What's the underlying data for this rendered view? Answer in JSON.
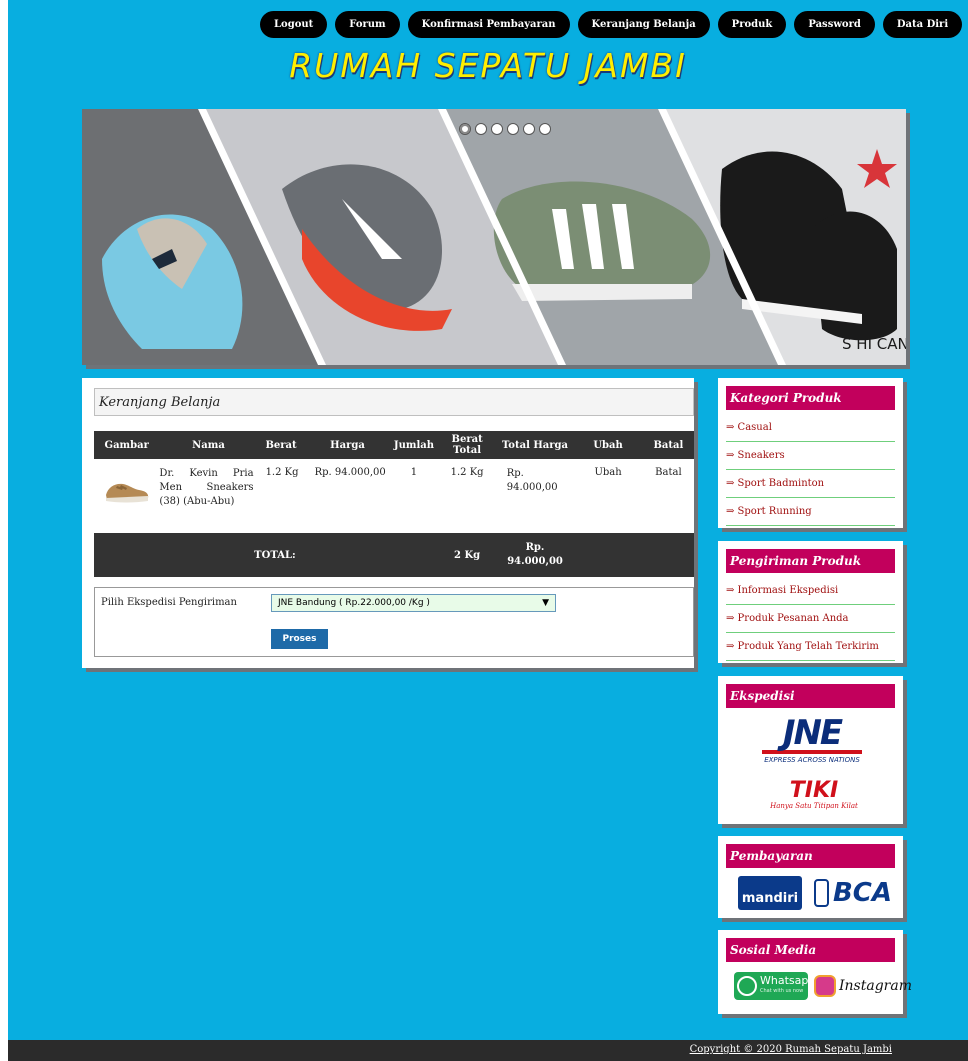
{
  "nav": {
    "items": [
      "Logout",
      "Forum",
      "Konfirmasi Pembayaran",
      "Keranjang Belanja",
      "Produk",
      "Password",
      "Data Diri"
    ]
  },
  "site": {
    "title": "RUMAH SEPATU JAMBI",
    "title_color": "#ffee00",
    "background_color": "#08aee0"
  },
  "banner": {
    "slide_count": 6,
    "active_slide": 1,
    "caption": "S HI CAN"
  },
  "main": {
    "heading": "Keranjang Belanja",
    "cart": {
      "columns": [
        "Gambar",
        "Nama",
        "Berat",
        "Harga",
        "Jumlah",
        "Berat Total",
        "Total Harga",
        "Ubah",
        "Batal"
      ],
      "rows": [
        {
          "image": "shoe-icon",
          "name": "Dr. Kevin Pria Men Sneakers (38) (Abu-Abu)",
          "weight": "1.2 Kg",
          "price": "Rp. 94.000,00",
          "qty": "1",
          "total_weight": "1.2 Kg",
          "total_price": "Rp. 94.000,00",
          "edit": "Ubah",
          "cancel": "Batal"
        }
      ],
      "total": {
        "label": "TOTAL:",
        "weight": "2 Kg",
        "price": "Rp. 94.000,00"
      }
    },
    "shipping": {
      "label": "Pilih Ekspedisi Pengiriman",
      "selected": "JNE Bandung ( Rp.22.000,00 /Kg )",
      "submit": "Proses"
    }
  },
  "sidebar": {
    "kategori": {
      "title": "Kategori Produk",
      "items": [
        "⇒ Casual",
        "⇒ Sneakers",
        "⇒ Sport Badminton",
        "⇒ Sport Running"
      ]
    },
    "pengiriman": {
      "title": "Pengiriman Produk",
      "items": [
        "⇒ Informasi Ekspedisi",
        "⇒ Produk Pesanan Anda",
        "⇒ Produk Yang Telah Terkirim"
      ]
    },
    "ekspedisi": {
      "title": "Ekspedisi",
      "jne_logo": "JNE",
      "jne_tagline": "EXPRESS ACROSS NATIONS",
      "tiki_logo": "TIKI",
      "tiki_tagline": "Hanya Satu Titipan Kilat"
    },
    "pembayaran": {
      "title": "Pembayaran",
      "bank1": "mandiri",
      "bank2": "BCA"
    },
    "sosial": {
      "title": "Sosial Media",
      "whatsapp": "Whatsapp",
      "whatsapp_sub": "Chat with us now",
      "instagram": "Instagram"
    }
  },
  "footer": {
    "copyright": "Copyright © 2020 Rumah Sepatu Jambi"
  }
}
